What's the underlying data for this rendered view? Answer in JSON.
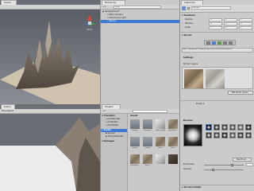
{
  "scene_view": {
    "tab_label": "Scene",
    "persp_label": "Persp",
    "colors": {
      "sky": "#6a6e76",
      "ground": "#cfc2ae",
      "terrain": "#7a6f63"
    }
  },
  "game_view": {
    "tab_label": "Game",
    "toolbar_label": "Free Aspect",
    "colors": {
      "sky": "#6b6f74",
      "ground": "#e6e6e6"
    }
  },
  "hierarchy": {
    "tab_label": "Hierarchy",
    "search_placeholder": "Q-All",
    "scene_name": "SampleScene*",
    "items": [
      "Main Camera",
      "Directional Light",
      "Terrain"
    ],
    "selected_index": 2
  },
  "project": {
    "tab_label": "Project",
    "search_placeholder": "",
    "favorites_label": "Favorites",
    "favorites_items": [
      "All Materials",
      "All Models",
      "All Prefabs"
    ],
    "assets_label": "Assets",
    "asset_folders": [
      "Scenes",
      "Tiling Materials"
    ],
    "packages_label": "Packages",
    "breadcrumb": "Assets",
    "asset_tiles": [
      {
        "name": "Scenes",
        "kind": "folder"
      },
      {
        "name": "Tiling Ma..",
        "kind": "folder"
      },
      {
        "name": "New Terrain",
        "kind": "cube"
      },
      {
        "name": "MossRock..",
        "kind": "stone"
      },
      {
        "name": "Terrain..",
        "kind": "folder"
      },
      {
        "name": "Stones",
        "kind": "folder"
      },
      {
        "name": "Rock..",
        "kind": "stone"
      },
      {
        "name": "Rock..",
        "kind": "stone"
      },
      {
        "name": "Mossrock..",
        "kind": "stone"
      },
      {
        "name": "Rock..",
        "kind": "stone"
      },
      {
        "name": "",
        "kind": "cube"
      },
      {
        "name": "",
        "kind": "dark"
      }
    ]
  },
  "inspector": {
    "tab_label": "Inspector",
    "object_name": "Terrain",
    "transform_label": "Transform",
    "transform_rows": [
      "Position",
      "Rotation",
      "Scale"
    ],
    "transform_values": [
      "0",
      "0",
      "0"
    ],
    "terrain_label": "Terrain",
    "help_text": "Paint the selected material layer onto the terrain texture.",
    "settings_label": "Settings",
    "layers_label": "Terrain Layers",
    "edit_layers_button": "Edit Terrain Layers...",
    "brushes_label": "Brushes",
    "brush_size_label": "Brush Size",
    "opacity_label": "Opacity",
    "new_brush_button": "New Brush...",
    "brush_name": "Brush_1",
    "collider_label": "Terrain Collider"
  }
}
